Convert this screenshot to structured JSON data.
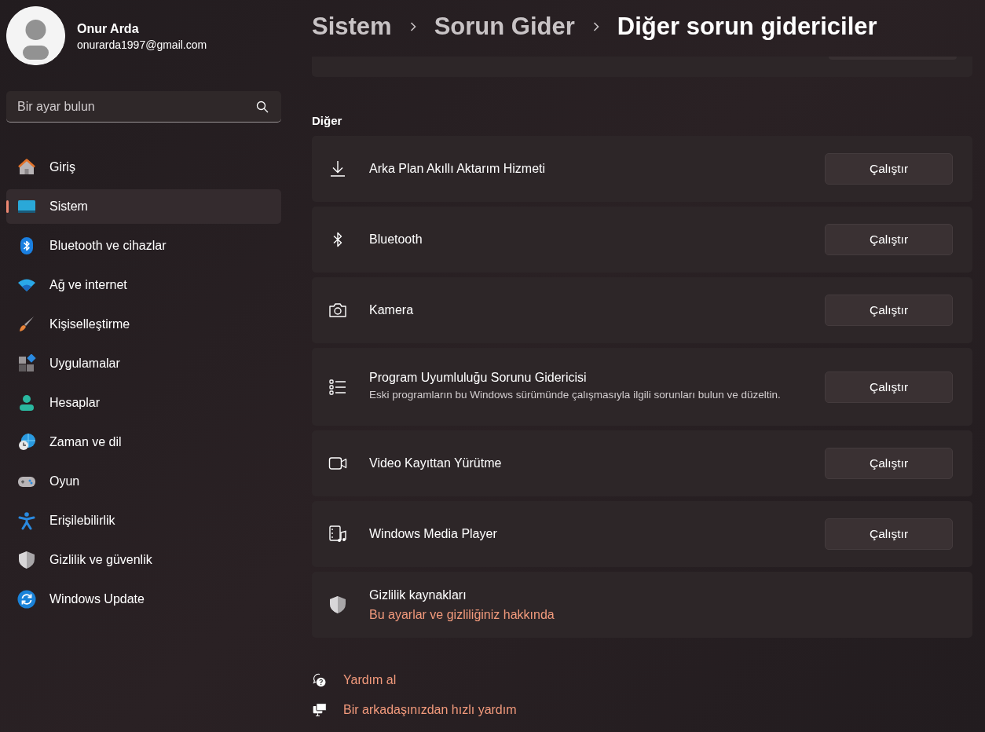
{
  "account": {
    "name": "Onur Arda",
    "email": "onurarda1997@gmail.com"
  },
  "search": {
    "placeholder": "Bir ayar bulun"
  },
  "sidebar": {
    "items": [
      {
        "label": "Giriş",
        "selected": false
      },
      {
        "label": "Sistem",
        "selected": true
      },
      {
        "label": "Bluetooth ve cihazlar",
        "selected": false
      },
      {
        "label": "Ağ ve internet",
        "selected": false
      },
      {
        "label": "Kişiselleştirme",
        "selected": false
      },
      {
        "label": "Uygulamalar",
        "selected": false
      },
      {
        "label": "Hesaplar",
        "selected": false
      },
      {
        "label": "Zaman ve dil",
        "selected": false
      },
      {
        "label": "Oyun",
        "selected": false
      },
      {
        "label": "Erişilebilirlik",
        "selected": false
      },
      {
        "label": "Gizlilik ve güvenlik",
        "selected": false
      },
      {
        "label": "Windows Update",
        "selected": false
      }
    ]
  },
  "breadcrumb": [
    "Sistem",
    "Sorun Gider",
    "Diğer sorun gidericiler"
  ],
  "section": {
    "title": "Diğer",
    "items": [
      {
        "kind": "troubleshooter",
        "title": "Arka Plan Akıllı Aktarım Hizmeti",
        "button": "Çalıştır"
      },
      {
        "kind": "troubleshooter",
        "title": "Bluetooth",
        "button": "Çalıştır"
      },
      {
        "kind": "troubleshooter",
        "title": "Kamera",
        "button": "Çalıştır"
      },
      {
        "kind": "troubleshooter",
        "title": "Program Uyumluluğu Sorunu Gidericisi",
        "description": "Eski programların bu Windows sürümünde çalışmasıyla ilgili sorunları bulun ve düzeltin.",
        "button": "Çalıştır"
      },
      {
        "kind": "troubleshooter",
        "title": "Video Kayıttan Yürütme",
        "button": "Çalıştır"
      },
      {
        "kind": "troubleshooter",
        "title": "Windows Media Player",
        "button": "Çalıştır"
      },
      {
        "kind": "link",
        "title": "Gizlilik kaynakları",
        "link": "Bu ayarlar ve gizliliğiniz hakkında"
      }
    ]
  },
  "help_links": [
    "Yardım al",
    "Bir arkadaşınızdan hızlı yardım"
  ]
}
